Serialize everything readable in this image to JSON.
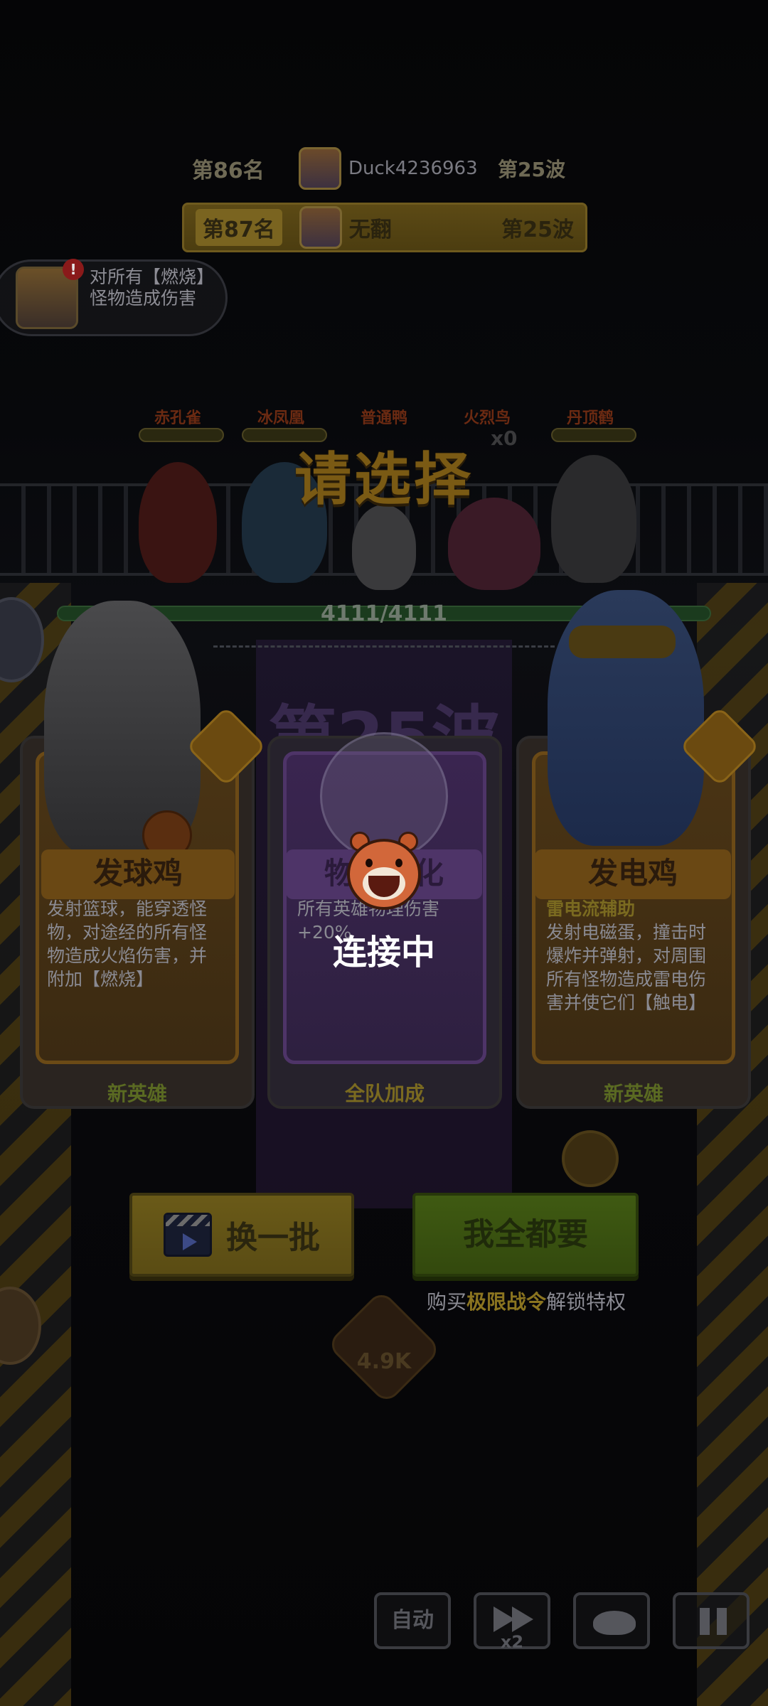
{
  "leaderboard": {
    "row1": {
      "rank": "第86名",
      "name": "Duck4236963",
      "wave": "第25波"
    },
    "row2": {
      "rank": "第87名",
      "name": "无翻",
      "wave": "第25波"
    }
  },
  "buff": {
    "text": "对所有【燃烧】怪物造成伤害",
    "badge": "!"
  },
  "heroes": [
    {
      "name": "赤孔雀"
    },
    {
      "name": "冰凤凰"
    },
    {
      "name": "普通鸭"
    },
    {
      "name": "火烈鸟"
    },
    {
      "name": "丹顶鹤"
    }
  ],
  "hero_counter": "x0",
  "hp": "4111/4111",
  "wave_watermark": "第25波",
  "title": "请选择",
  "cards": [
    {
      "name": "发球鸡",
      "subtitle": "",
      "desc": "发射篮球，能穿透怪物，对途经的所有怪物造成火焰伤害，并附加【燃烧】",
      "footer": "新英雄"
    },
    {
      "name": "物理强化",
      "subtitle": "",
      "desc": "所有英雄物理伤害+20%",
      "footer": "全队加成"
    },
    {
      "name": "发电鸡",
      "subtitle": "雷电流辅助",
      "desc": "发射电磁蛋，撞击时爆炸并弹射，对周围所有怪物造成雷电伤害并使它们【触电】",
      "footer": "新英雄"
    }
  ],
  "buttons": {
    "swap": "换一批",
    "take_all": "我全都要"
  },
  "unlock": {
    "prefix": "购买",
    "highlight": "极限战令",
    "suffix": "解锁特权"
  },
  "coin_value": "4.9K",
  "toolbar": {
    "auto": "自动",
    "speed": "x2"
  },
  "loading": {
    "text": "连接中"
  },
  "colors": {
    "accent_gold": "#f5c52a",
    "accent_green": "#8cc63f",
    "card_purple": "#7b4fb0"
  }
}
